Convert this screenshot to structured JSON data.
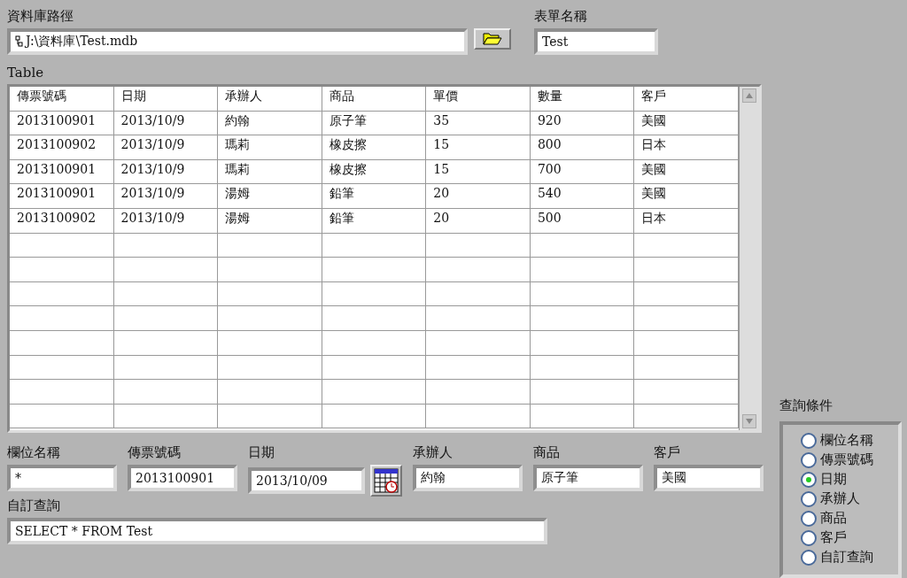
{
  "db_path": {
    "label": "資料庫路徑",
    "value": "J:\\資料庫\\Test.mdb"
  },
  "form_name": {
    "label": "表單名稱",
    "value": "Test"
  },
  "table": {
    "label": "Table",
    "columns": [
      "傳票號碼",
      "日期",
      "承辦人",
      "商品",
      "單價",
      "數量",
      "客戶"
    ],
    "rows": [
      [
        "2013100901",
        "2013/10/9",
        "約翰",
        "原子筆",
        "35",
        "920",
        "美國"
      ],
      [
        "2013100902",
        "2013/10/9",
        "瑪莉",
        "橡皮擦",
        "15",
        "800",
        "日本"
      ],
      [
        "2013100901",
        "2013/10/9",
        "瑪莉",
        "橡皮擦",
        "15",
        "700",
        "美國"
      ],
      [
        "2013100901",
        "2013/10/9",
        "湯姆",
        "鉛筆",
        "20",
        "540",
        "美國"
      ],
      [
        "2013100902",
        "2013/10/9",
        "湯姆",
        "鉛筆",
        "20",
        "500",
        "日本"
      ]
    ]
  },
  "filters": [
    {
      "label": "欄位名稱",
      "value": "*",
      "kind": "text"
    },
    {
      "label": "傳票號碼",
      "value": "2013100901",
      "kind": "text"
    },
    {
      "label": "日期",
      "value": "2013/10/09",
      "kind": "date"
    },
    {
      "label": "承辦人",
      "value": "約翰",
      "kind": "text"
    },
    {
      "label": "商品",
      "value": "原子筆",
      "kind": "text"
    },
    {
      "label": "客戶",
      "value": "美國",
      "kind": "text"
    }
  ],
  "custom_query": {
    "label": "自訂查詢",
    "value": "SELECT * FROM Test"
  },
  "query_condition": {
    "label": "查詢條件",
    "options": [
      {
        "label": "欄位名稱",
        "selected": false
      },
      {
        "label": "傳票號碼",
        "selected": false
      },
      {
        "label": "日期",
        "selected": true
      },
      {
        "label": "承辦人",
        "selected": false
      },
      {
        "label": "商品",
        "selected": false
      },
      {
        "label": "客戶",
        "selected": false
      },
      {
        "label": "自訂查詢",
        "selected": false
      }
    ]
  }
}
